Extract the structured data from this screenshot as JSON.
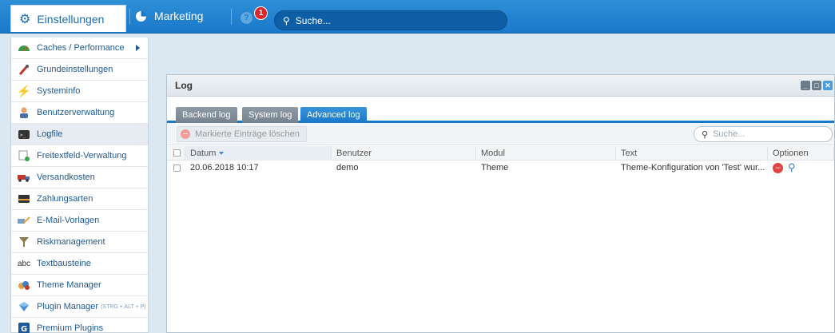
{
  "topbar": {
    "settings_label": "Einstellungen",
    "marketing_label": "Marketing",
    "help_symbol": "?",
    "notification_count": "1",
    "search_placeholder": "Suche..."
  },
  "sidebar": {
    "items": [
      {
        "label": "Caches / Performance",
        "icon": "speedometer-icon",
        "hint": ""
      },
      {
        "label": "Grundeinstellungen",
        "icon": "wrench-icon",
        "hint": ""
      },
      {
        "label": "Systeminfo",
        "icon": "lightning-icon",
        "hint": ""
      },
      {
        "label": "Benutzerverwaltung",
        "icon": "user-icon",
        "hint": ""
      },
      {
        "label": "Logfile",
        "icon": "terminal-icon",
        "hint": ""
      },
      {
        "label": "Freitextfeld-Verwaltung",
        "icon": "form-add-icon",
        "hint": ""
      },
      {
        "label": "Versandkosten",
        "icon": "truck-icon",
        "hint": ""
      },
      {
        "label": "Zahlungsarten",
        "icon": "credit-card-icon",
        "hint": ""
      },
      {
        "label": "E-Mail-Vorlagen",
        "icon": "mail-icon",
        "hint": ""
      },
      {
        "label": "Riskmanagement",
        "icon": "filter-icon",
        "hint": ""
      },
      {
        "label": "Textbausteine",
        "icon": "abc-icon",
        "hint": ""
      },
      {
        "label": "Theme Manager",
        "icon": "palette-icon",
        "hint": ""
      },
      {
        "label": "Plugin Manager",
        "icon": "plugin-icon",
        "hint": "(STRG + ALT + P)"
      },
      {
        "label": "Premium Plugins",
        "icon": "premium-icon",
        "hint": ""
      }
    ]
  },
  "window": {
    "title": "Log",
    "tabs": [
      "Backend log",
      "System log",
      "Advanced log"
    ],
    "active_tab": "Advanced log",
    "delete_button": "Markierte Einträge löschen",
    "search_placeholder": "Suche...",
    "columns": [
      "Datum",
      "Benutzer",
      "Modul",
      "Text",
      "Optionen"
    ],
    "rows": [
      {
        "date": "20.06.2018 10:17",
        "user": "demo",
        "module": "Theme",
        "text": "Theme-Konfiguration von 'Test' wur..."
      }
    ]
  },
  "colors": {
    "topbar": "#1a78c9",
    "accent": "#1a78c9",
    "danger": "#e04545",
    "background": "#dbe8f1"
  }
}
